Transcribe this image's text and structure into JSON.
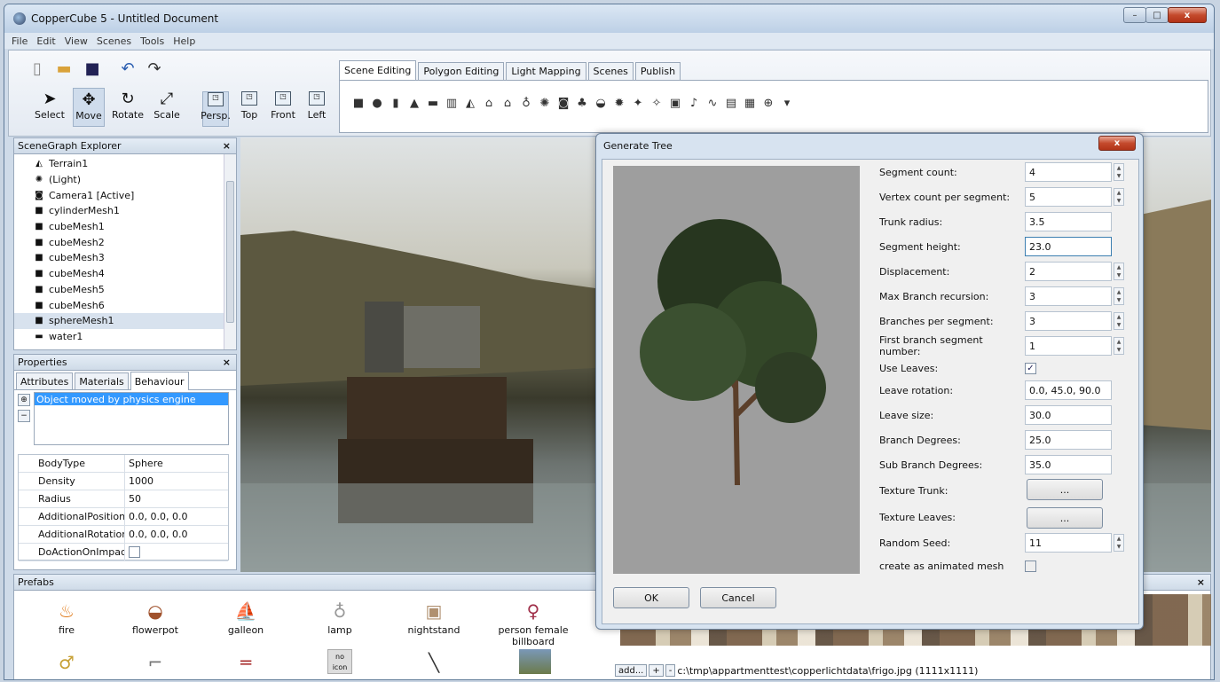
{
  "window": {
    "title": "CopperCube 5 - Untitled Document",
    "buttons": {
      "minimize": "–",
      "maximize": "□",
      "close": "x"
    }
  },
  "menu": [
    "File",
    "Edit",
    "View",
    "Scenes",
    "Tools",
    "Help"
  ],
  "toolbar": {
    "tools": [
      "Select",
      "Move",
      "Rotate",
      "Scale"
    ],
    "views": [
      "Persp.",
      "Top",
      "Front",
      "Left"
    ],
    "tabs": [
      "Scene Editing",
      "Polygon Editing",
      "Light Mapping",
      "Scenes",
      "Publish"
    ]
  },
  "scenegraph": {
    "title": "SceneGraph Explorer",
    "items": [
      "Terrain1",
      "(Light)",
      "Camera1 [Active]",
      "cylinderMesh1",
      "cubeMesh1",
      "cubeMesh2",
      "cubeMesh3",
      "cubeMesh4",
      "cubeMesh5",
      "cubeMesh6",
      "sphereMesh1",
      "water1"
    ]
  },
  "properties": {
    "title": "Properties",
    "tabs": [
      "Attributes",
      "Materials",
      "Behaviour"
    ],
    "behaviour_item": "Object moved by physics engine",
    "rows": [
      {
        "key": "BodyType",
        "value": "Sphere"
      },
      {
        "key": "Density",
        "value": "1000"
      },
      {
        "key": "Radius",
        "value": "50"
      },
      {
        "key": "AdditionalPosition",
        "value": "0.0, 0.0, 0.0"
      },
      {
        "key": "AdditionalRotation",
        "value": "0.0, 0.0, 0.0"
      },
      {
        "key": "DoActionOnImpact",
        "value": ""
      }
    ]
  },
  "prefabs": {
    "title": "Prefabs",
    "items": [
      "fire",
      "flowerpot",
      "galleon",
      "lamp",
      "nightstand",
      "person female billboard"
    ],
    "noicon": "no icon"
  },
  "statusbar": {
    "add": "add...",
    "plus": "+",
    "minus": "-",
    "path": "c:\\tmp\\appartmenttest\\copperlichtdata\\frigo.jpg (1111x1111)"
  },
  "dialog": {
    "title": "Generate Tree",
    "fields": [
      {
        "label": "Segment count:",
        "value": "4",
        "spin": true
      },
      {
        "label": "Vertex count per segment:",
        "value": "5",
        "spin": true
      },
      {
        "label": "Trunk radius:",
        "value": "3.5",
        "spin": false
      },
      {
        "label": "Segment height:",
        "value": "23.0",
        "spin": false
      },
      {
        "label": "Displacement:",
        "value": "2",
        "spin": true
      },
      {
        "label": "Max Branch recursion:",
        "value": "3",
        "spin": true
      },
      {
        "label": "Branches per segment:",
        "value": "3",
        "spin": true
      },
      {
        "label": "First branch segment number:",
        "value": "1",
        "spin": true
      }
    ],
    "use_leaves_label": "Use Leaves:",
    "use_leaves_checked": "✓",
    "fields2": [
      {
        "label": "Leave rotation:",
        "value": "0.0, 45.0, 90.0"
      },
      {
        "label": "Leave size:",
        "value": "30.0"
      },
      {
        "label": "Branch Degrees:",
        "value": "25.0"
      },
      {
        "label": "Sub Branch Degrees:",
        "value": "35.0"
      }
    ],
    "texture_trunk_label": "Texture Trunk:",
    "texture_leaves_label": "Texture Leaves:",
    "browse": "...",
    "random_seed_label": "Random Seed:",
    "random_seed_value": "11",
    "animated_label": "create as animated mesh",
    "ok": "OK",
    "cancel": "Cancel"
  }
}
